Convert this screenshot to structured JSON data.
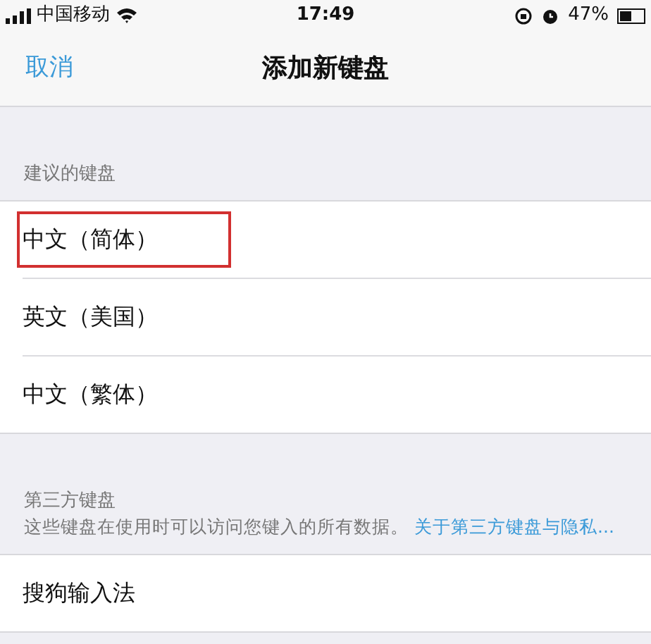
{
  "status_bar": {
    "carrier": "中国移动",
    "time": "17:49",
    "battery": "47%"
  },
  "nav": {
    "cancel": "取消",
    "title": "添加新键盘"
  },
  "sections": [
    {
      "header": "建议的键盘",
      "items": [
        {
          "label": "中文（简体）",
          "highlighted": true
        },
        {
          "label": "英文（美国）",
          "highlighted": false
        },
        {
          "label": "中文（繁体）",
          "highlighted": false
        }
      ]
    },
    {
      "header": "第三方键盘",
      "note": "这些键盘在使用时可以访问您键入的所有数据。",
      "link": "关于第三方键盘与隐私...",
      "items": [
        {
          "label": "搜狗输入法",
          "highlighted": false
        }
      ]
    }
  ]
}
